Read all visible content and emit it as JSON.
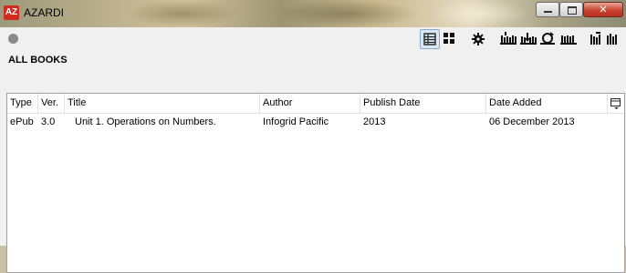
{
  "window": {
    "app_logo_text": "AZ",
    "title": "AZARDI",
    "controls": {
      "minimize": "minimize",
      "maximize": "maximize",
      "close": "close"
    }
  },
  "toolbar": {
    "buttons": [
      {
        "name": "list-view",
        "icon": "list-view-icon",
        "active": true
      },
      {
        "name": "grid-view",
        "icon": "grid-view-icon",
        "active": false
      },
      {
        "name": "settings",
        "icon": "gear-icon",
        "active": false
      },
      {
        "name": "add-books",
        "icon": "add-books-icon",
        "active": false
      },
      {
        "name": "import-books",
        "icon": "import-books-icon",
        "active": false
      },
      {
        "name": "sync-library",
        "icon": "sync-icon",
        "active": false
      },
      {
        "name": "library-shelf",
        "icon": "shelf-icon",
        "active": false
      },
      {
        "name": "shelf-manage",
        "icon": "shelf-manage-icon",
        "active": false
      },
      {
        "name": "shelf-books",
        "icon": "shelf-books-icon",
        "active": false
      }
    ]
  },
  "library": {
    "section_title": "ALL BOOKS",
    "columns": [
      "Type",
      "Ver.",
      "Title",
      "Author",
      "Publish Date",
      "Date Added"
    ],
    "rows": [
      {
        "type": "ePub",
        "version": "3.0",
        "title": "Unit 1. Operations on Numbers.",
        "author": "Infogrid Pacific",
        "publish_date": "2013",
        "date_added": "06 December 2013"
      }
    ]
  },
  "colors": {
    "logo_red": "#d22b20",
    "close_red": "#c8432f",
    "active_button": "#dbe7f4"
  }
}
